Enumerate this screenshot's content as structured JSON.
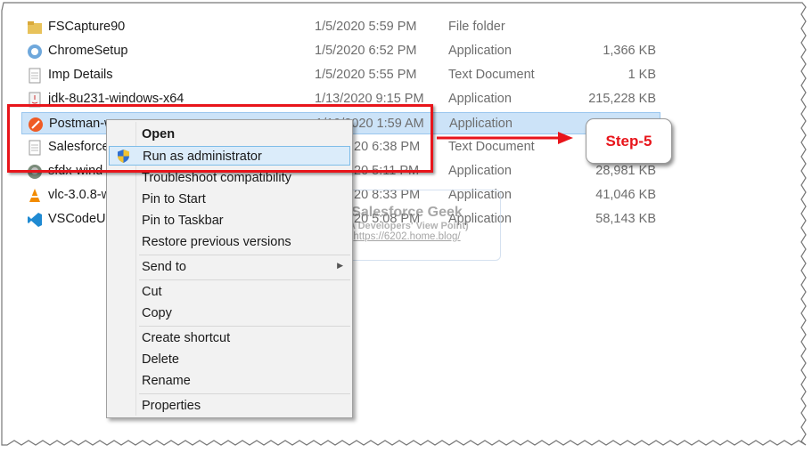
{
  "files": [
    {
      "name": "FSCapture90",
      "date": "1/5/2020 5:59 PM",
      "type": "File folder",
      "size": "",
      "icon": "folder-icon"
    },
    {
      "name": "ChromeSetup",
      "date": "1/5/2020 6:52 PM",
      "type": "Application",
      "size": "1,366 KB",
      "icon": "installer-icon"
    },
    {
      "name": "Imp Details",
      "date": "1/5/2020 5:55 PM",
      "type": "Text Document",
      "size": "1 KB",
      "icon": "text-file-icon"
    },
    {
      "name": "jdk-8u231-windows-x64",
      "date": "1/13/2020 9:15 PM",
      "type": "Application",
      "size": "215,228 KB",
      "icon": "java-icon"
    },
    {
      "name": "Postman-w",
      "date": "1/10/2020 1:59 AM",
      "type": "Application",
      "size": "",
      "icon": "postman-icon"
    },
    {
      "name": "Salesforce",
      "date": "20 6:38 PM",
      "type": "Text Document",
      "size": "",
      "icon": "text-file-icon"
    },
    {
      "name": "sfdx-wind",
      "date": "20 5:11 PM",
      "type": "Application",
      "size": "28,981 KB",
      "icon": "sfdx-icon"
    },
    {
      "name": "vlc-3.0.8-w",
      "date": "20 8:33 PM",
      "type": "Application",
      "size": "41,046 KB",
      "icon": "vlc-icon"
    },
    {
      "name": "VSCodeUs",
      "date": "20 5:08 PM",
      "type": "Application",
      "size": "58,143 KB",
      "icon": "vscode-icon"
    }
  ],
  "menu": {
    "open": "Open",
    "run_admin": "Run as administrator",
    "troubleshoot": "Troubleshoot compatibility",
    "pin_start": "Pin to Start",
    "pin_taskbar": "Pin to Taskbar",
    "restore": "Restore previous versions",
    "send_to": "Send to",
    "cut": "Cut",
    "copy": "Copy",
    "create_shortcut": "Create shortcut",
    "delete": "Delete",
    "rename": "Rename",
    "properties": "Properties"
  },
  "callout": {
    "label": "Step-5",
    "color": "#e8151b"
  },
  "watermark": {
    "title": "Salesforce Geek",
    "subtitle": "(A Developers' View Point)",
    "url": "https://6202.home.blog/"
  }
}
